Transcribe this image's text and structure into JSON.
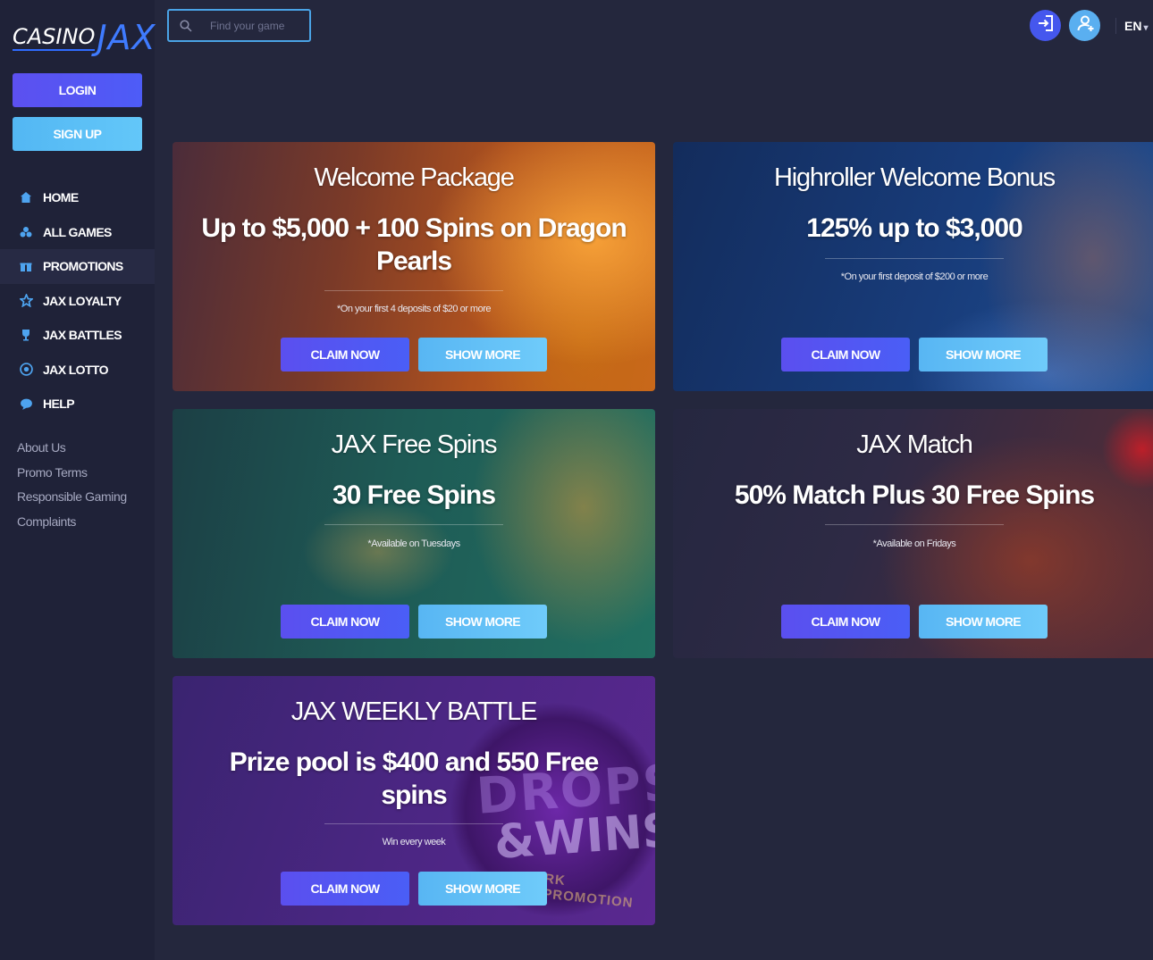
{
  "brand": {
    "logo_casino": "CASINO",
    "logo_jax": "JAX"
  },
  "auth": {
    "login_label": "LOGIN",
    "signup_label": "SIGN UP"
  },
  "search": {
    "placeholder": "Find your game"
  },
  "header": {
    "language": "EN"
  },
  "nav": {
    "items": [
      {
        "label": "HOME",
        "icon": "home-icon"
      },
      {
        "label": "ALL GAMES",
        "icon": "games-icon"
      },
      {
        "label": "PROMOTIONS",
        "icon": "gift-icon",
        "active": true
      },
      {
        "label": "JAX LOYALTY",
        "icon": "star-icon"
      },
      {
        "label": "JAX BATTLES",
        "icon": "trophy-icon"
      },
      {
        "label": "JAX LOTTO",
        "icon": "lotto-icon"
      },
      {
        "label": "HELP",
        "icon": "chat-icon"
      }
    ]
  },
  "footer_links": [
    "About Us",
    "Promo Terms",
    "Responsible Gaming",
    "Complaints"
  ],
  "promos": [
    {
      "title": "Welcome Package",
      "offer": "Up to $5,000 + 100 Spins on Dragon Pearls",
      "note": "*On your first 4 deposits of $20 or more",
      "claim": "CLAIM NOW",
      "more": "SHOW MORE"
    },
    {
      "title": "Highroller Welcome Bonus",
      "offer": "125% up to $3,000",
      "note": "*On your first deposit of $200 or more",
      "claim": "CLAIM NOW",
      "more": "SHOW MORE"
    },
    {
      "title": "JAX Free Spins",
      "offer": "30 Free Spins",
      "note": "*Available on Tuesdays",
      "claim": "CLAIM NOW",
      "more": "SHOW MORE"
    },
    {
      "title": "JAX Match",
      "offer": "50% Match Plus 30 Free Spins",
      "note": "*Available on Fridays",
      "claim": "CLAIM NOW",
      "more": "SHOW MORE"
    },
    {
      "title": "JAX WEEKLY BATTLE",
      "offer": "Prize pool is $400 and 550 Free spins",
      "note": "Win every week",
      "claim": "CLAIM NOW",
      "more": "SHOW MORE",
      "art_text": {
        "drops": "DROPS",
        "wins": "&WINS",
        "ribbon": "RK PROMOTION"
      }
    }
  ],
  "colors": {
    "background": "#24273d",
    "sidebar": "#1f2238",
    "accent_blue": "#4ea4f0",
    "claim_button": "#5b4fef",
    "more_button": "#63c7f9"
  }
}
